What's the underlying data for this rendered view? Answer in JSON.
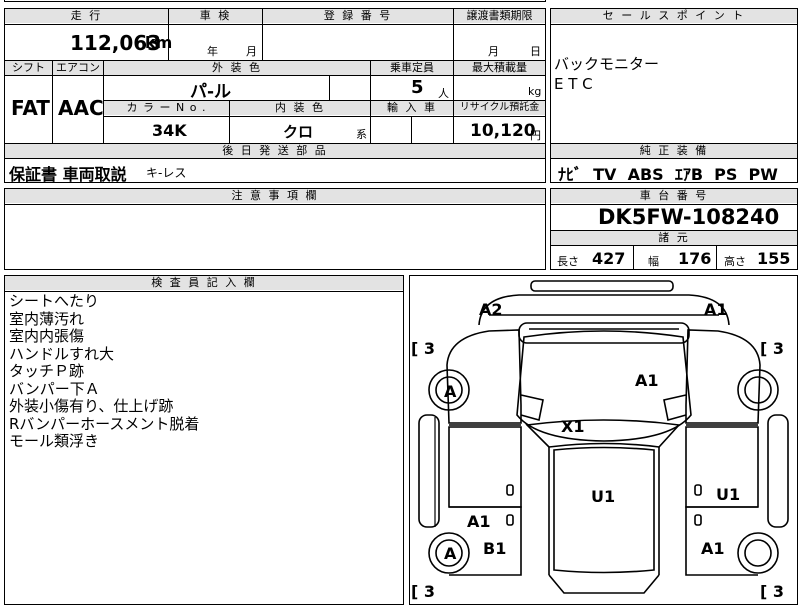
{
  "vehicle": {
    "mileage_header": "走 行",
    "mileage_value": "112,063",
    "mileage_unit": "km",
    "inspection_header": "車 検",
    "inspection_year_label": "年",
    "inspection_month_label": "月",
    "registration_header": "登 録 番 号",
    "transfer_header": "譲渡書類期限",
    "transfer_month_label": "月",
    "transfer_day_label": "日",
    "shift_header": "シフト",
    "shift_value": "FAT",
    "aircon_header": "エアコン",
    "aircon_value": "AAC",
    "exterior_header": "外 装 色",
    "exterior_value": "パ-ル",
    "capacity_header": "乗車定員",
    "capacity_value": "5",
    "capacity_unit": "人",
    "maxload_header": "最大積載量",
    "maxload_unit": "kg",
    "colorno_header": "カ ラ ー N o .",
    "colorno_value": "34K",
    "interior_header": "内 装 色",
    "interior_value": "クロ",
    "interior_unit": "系",
    "import_header": "輸 入 車",
    "recycle_header": "リサイクル預託金",
    "recycle_value": "10,120",
    "recycle_unit": "円",
    "later_parts_header": "後 日 発 送 部 品",
    "later_parts_value_main": "保証書 車両取説",
    "later_parts_value_small": "キ-レス",
    "caution_header": "注 意 事 項 欄"
  },
  "sales_point": {
    "header": "セ ー ル ス ポ イ ン ト",
    "lines": [
      "バックモニター",
      "E T C"
    ]
  },
  "genuine_equipment": {
    "header": "純 正 装 備",
    "value": "ﾅﾋﾞ  TV  ABS  ｴｱB  PS  PW"
  },
  "chassis": {
    "header": "車 台 番 号",
    "value": "DK5FW-108240"
  },
  "specs": {
    "header": "諸 元",
    "length_label": "長さ",
    "length_value": "427",
    "width_label": "幅",
    "width_value": "176",
    "height_label": "高さ",
    "height_value": "155"
  },
  "inspector": {
    "header": "検 査 員 記 入 欄",
    "notes": [
      "シートへたり",
      "室内薄汚れ",
      "室内内張傷",
      "ハンドルすれ大",
      "タッチＰ跡",
      "バンパー下Ａ",
      "外装小傷有り、仕上げ跡",
      "Rバンパーホースメント脱着",
      "モール類浮き"
    ]
  },
  "diagram": {
    "marks": {
      "front_left": "A2",
      "front_right": "A1",
      "hood": "A1",
      "windshield": "X1",
      "roof": "U1",
      "right_door": "U1",
      "left_rear_door": "A1",
      "left_sill": "B1",
      "right_rear": "A1",
      "front_left_wheel": "A",
      "rear_left_wheel": "A"
    },
    "tread": {
      "front_left": "[ 3",
      "front_right": "[ 3",
      "rear_left": "[ 3",
      "rear_right": "[ 3"
    }
  }
}
